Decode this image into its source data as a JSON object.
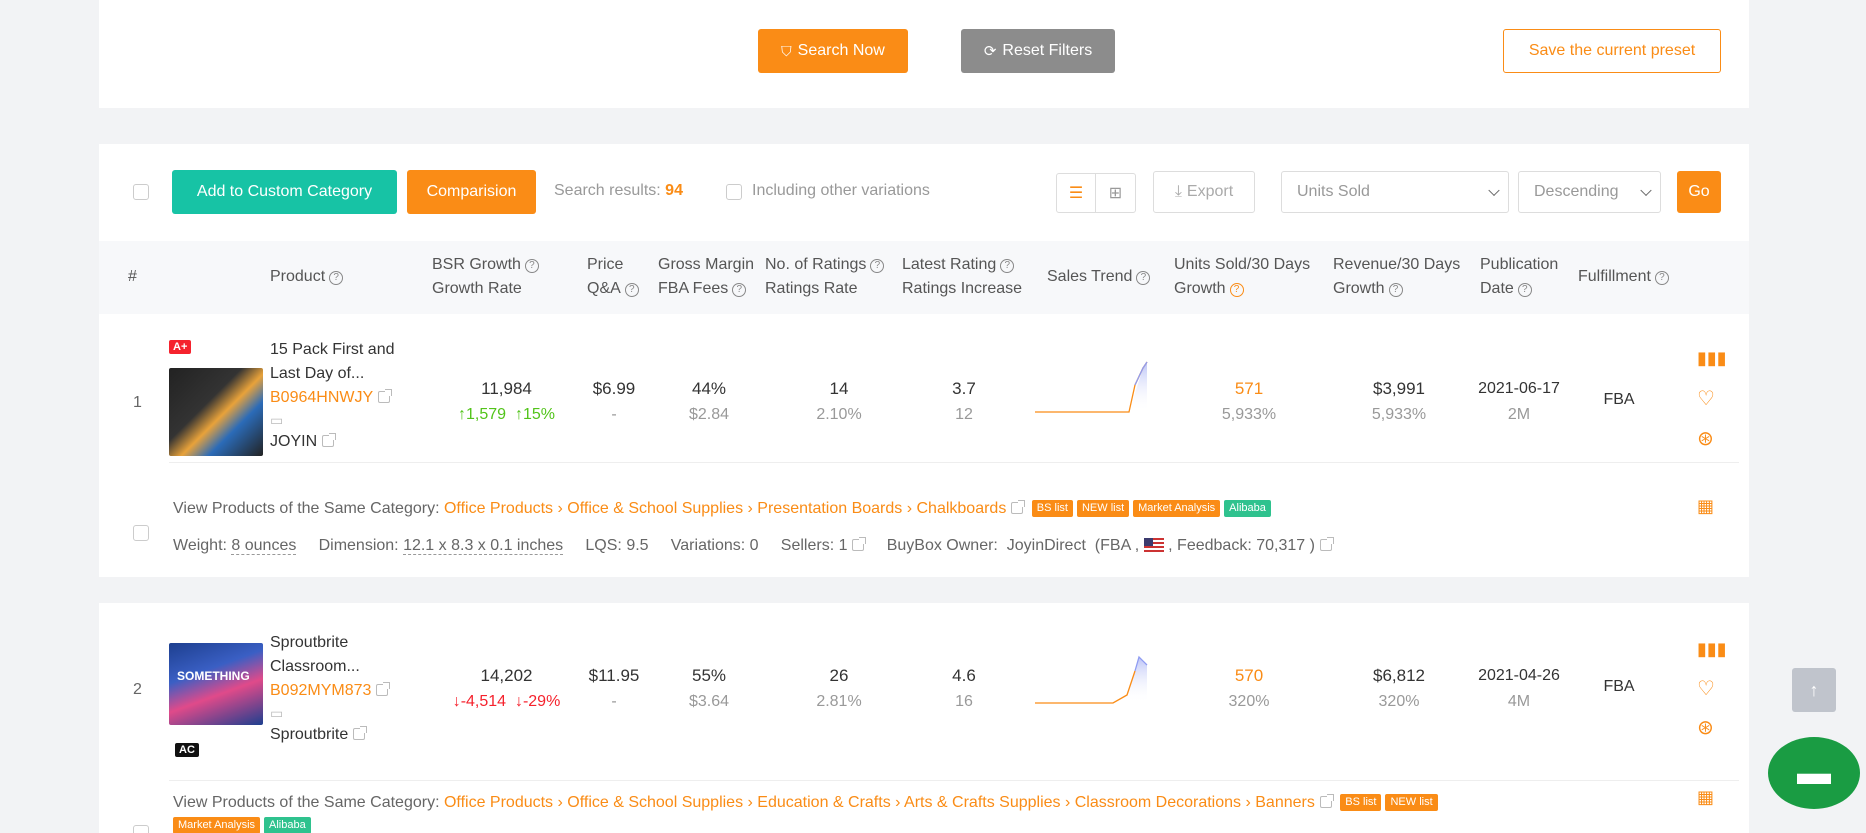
{
  "top_bar": {
    "search_now": "Search Now",
    "reset_filters": "Reset Filters",
    "save_preset": "Save the current preset"
  },
  "toolbar": {
    "add_custom_category": "Add to Custom Category",
    "comparison": "Comparision",
    "search_results_label": "Search results:",
    "search_results_count": "94",
    "including_variations": "Including other variations",
    "export": "Export",
    "sort_field": "Units Sold",
    "sort_order": "Descending",
    "go": "Go"
  },
  "table_headers": {
    "index": "#",
    "product": "Product",
    "bsr_growth": "BSR Growth",
    "growth_rate": "Growth Rate",
    "price": "Price",
    "qa": "Q&A",
    "gross_margin": "Gross Margin",
    "fba_fees": "FBA Fees",
    "no_ratings": "No. of Ratings",
    "ratings_rate": "Ratings Rate",
    "latest_rating": "Latest Rating",
    "ratings_increase": "Ratings Increase",
    "sales_trend": "Sales Trend",
    "units_sold": "Units Sold/30 Days",
    "units_growth": "Growth",
    "revenue": "Revenue/30 Days",
    "revenue_growth": "Growth",
    "publication": "Publication",
    "date": "Date",
    "fulfillment": "Fulfillment"
  },
  "rows": [
    {
      "index": "1",
      "badge": "A+",
      "title_line1": "15 Pack First and",
      "title_line2": "Last Day of...",
      "asin": "B0964HNWJY",
      "brand": "JOYIN",
      "bsr": "11,984",
      "bsr_growth": "1,579",
      "bsr_rate": "15%",
      "price": "$6.99",
      "qa": "-",
      "gross_margin": "44%",
      "fba_fees": "$2.84",
      "ratings": "14",
      "ratings_rate": "2.10%",
      "latest_rating": "3.7",
      "ratings_increase": "12",
      "units_sold": "571",
      "units_growth": "5,933%",
      "revenue": "$3,991",
      "revenue_growth": "5,933%",
      "pub_date": "2021-06-17",
      "pub_age": "2M",
      "fulfillment": "FBA",
      "category_label": "View Products of the Same Category:",
      "category_path": "Office Products › Office & School Supplies › Presentation Boards › Chalkboards",
      "tag_bs": "BS list",
      "tag_new": "NEW list",
      "tag_market": "Market Analysis",
      "tag_alibaba": "Alibaba",
      "weight_label": "Weight:",
      "weight": "8 ounces",
      "dimension_label": "Dimension:",
      "dimension": "12.1 x 8.3 x 0.1 inches",
      "lqs": "LQS: 9.5",
      "variations": "Variations: 0",
      "sellers": "Sellers: 1",
      "buybox_label": "BuyBox Owner:",
      "buybox_owner": "JoyinDirect",
      "buybox_detail_a": "(FBA ,",
      "buybox_detail_b": ", Feedback: 70,317 )"
    },
    {
      "index": "2",
      "badge": "AC",
      "title_line1": "Sproutbrite",
      "title_line2": "Classroom...",
      "asin": "B092MYM873",
      "brand": "Sproutbrite",
      "bsr": "14,202",
      "bsr_growth": "-4,514",
      "bsr_rate": "-29%",
      "price": "$11.95",
      "qa": "-",
      "gross_margin": "55%",
      "fba_fees": "$3.64",
      "ratings": "26",
      "ratings_rate": "2.81%",
      "latest_rating": "4.6",
      "ratings_increase": "16",
      "units_sold": "570",
      "units_growth": "320%",
      "revenue": "$6,812",
      "revenue_growth": "320%",
      "pub_date": "2021-04-26",
      "pub_age": "4M",
      "fulfillment": "FBA",
      "category_label": "View Products of the Same Category:",
      "category_path": "Office Products › Office & School Supplies › Education & Crafts › Arts & Crafts Supplies › Classroom Decorations › Banners",
      "tag_bs": "BS list",
      "tag_new": "NEW list",
      "tag_market": "Market Analysis",
      "tag_alibaba": "Alibaba"
    }
  ],
  "colors": {
    "accent": "#fa8c16",
    "teal": "#17c3a5",
    "gray_button": "#8c8c8c",
    "chat": "#1a9c43"
  }
}
